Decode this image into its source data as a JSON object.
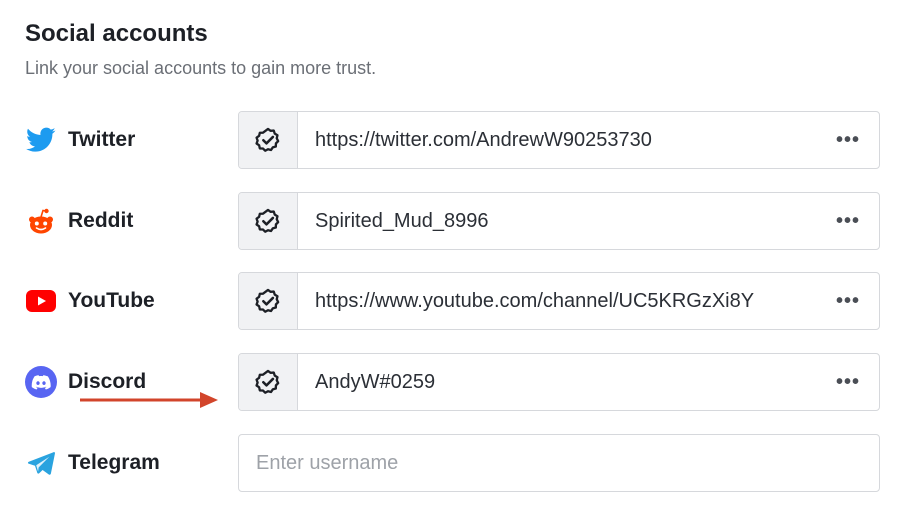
{
  "header": {
    "title": "Social accounts",
    "subtitle": "Link your social accounts to gain more trust."
  },
  "accounts": [
    {
      "name": "Twitter",
      "icon": "twitter-bird-icon",
      "icon_color": "#1d9bf0",
      "verified": true,
      "value": "https://twitter.com/AndrewW90253730",
      "more_label": "•••"
    },
    {
      "name": "Reddit",
      "icon": "reddit-alien-icon",
      "icon_color": "#ff4500",
      "verified": true,
      "value": "Spirited_Mud_8996",
      "more_label": "•••"
    },
    {
      "name": "YouTube",
      "icon": "youtube-play-icon",
      "icon_color": "#ff0000",
      "verified": true,
      "value": "https://www.youtube.com/channel/UC5KRGzXi8Y",
      "more_label": "•••"
    },
    {
      "name": "Discord",
      "icon": "discord-logo-icon",
      "icon_color": "#5865f2",
      "verified": true,
      "value": "AndyW#0259",
      "more_label": "•••"
    },
    {
      "name": "Telegram",
      "icon": "telegram-plane-icon",
      "icon_color": "#2aa3df",
      "verified": false,
      "value": "",
      "placeholder": "Enter username"
    }
  ],
  "annotation": {
    "arrow_color": "#d2452b"
  }
}
